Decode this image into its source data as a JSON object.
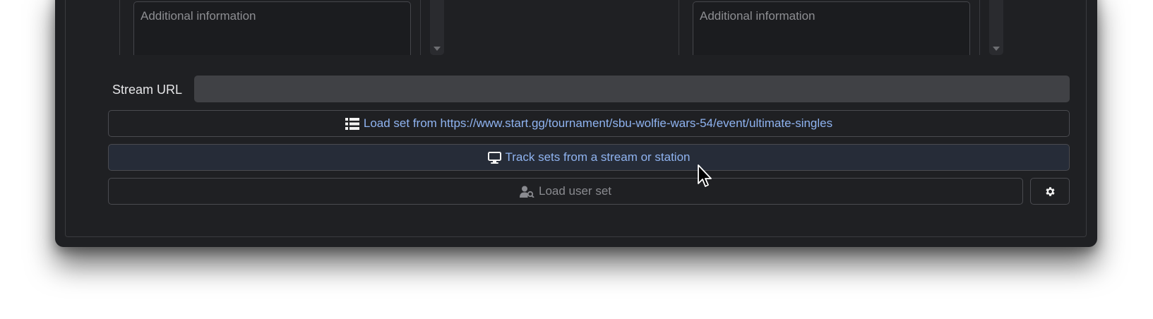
{
  "left_column": {
    "additional_info_placeholder": "Additional information"
  },
  "right_column": {
    "additional_info_placeholder": "Additional information"
  },
  "stream": {
    "label": "Stream URL",
    "value": "",
    "placeholder": ""
  },
  "buttons": {
    "load_set_label": "Load set from https://www.start.gg/tournament/sbu-wolfie-wars-54/event/ultimate-singles",
    "track_label": "Track sets from a stream or station",
    "load_user_label": "Load user set"
  },
  "icons": {
    "load_set": "list-icon",
    "track": "monitor-icon",
    "load_user": "user-search-icon",
    "settings": "gear-icon"
  },
  "colors": {
    "background": "#1f2023",
    "accent_text": "#8fb3f0",
    "track_button_bg": "#262c38",
    "input_bg": "#404145"
  }
}
